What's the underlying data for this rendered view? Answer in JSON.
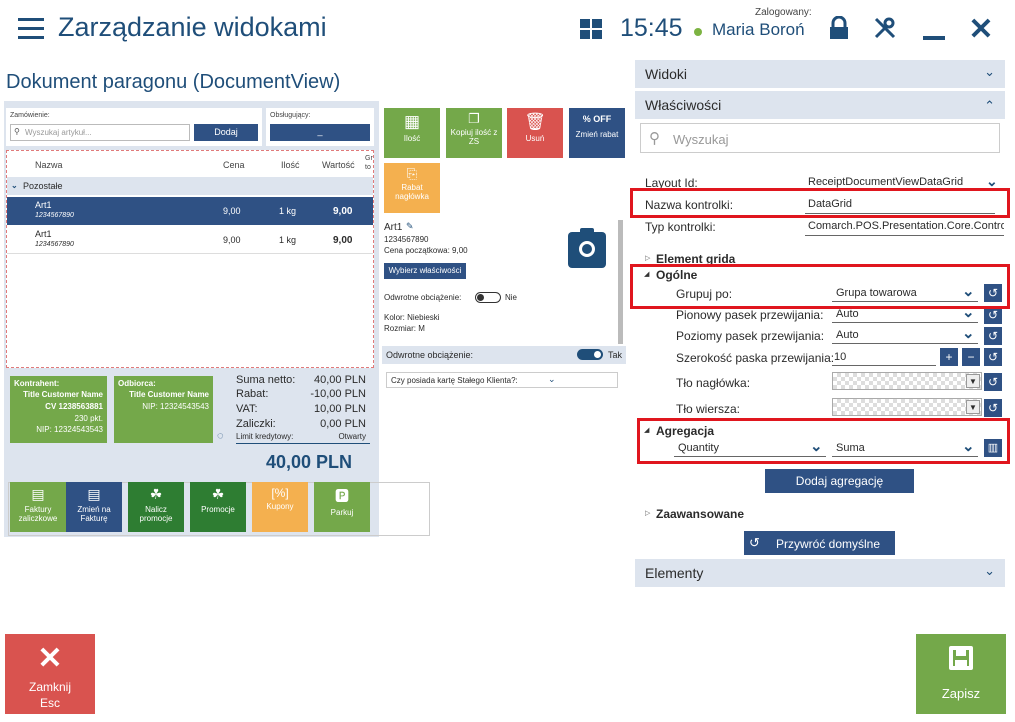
{
  "header": {
    "title": "Zarządzanie widokami",
    "time": "15:45",
    "logged_label": "Zalogowany:",
    "user": "Maria Boroń"
  },
  "document": {
    "title": "Dokument paragonu (DocumentView)"
  },
  "preview": {
    "order_label": "Zamówienie:",
    "search_placeholder": "Wyszukaj artykuł...",
    "add_button": "Dodaj",
    "served_label": "Obsługujący:",
    "served_value": "_",
    "grid": {
      "columns": [
        "Nazwa",
        "Cena",
        "Ilość",
        "Wartość"
      ],
      "extra_col": "Gr to",
      "group": "Pozostałe",
      "rows": [
        {
          "name": "Art1",
          "code": "1234567890",
          "price": "9,00",
          "qty": "1 kg",
          "value": "9,00"
        },
        {
          "name": "Art1",
          "code": "1234567890",
          "price": "9,00",
          "qty": "1 kg",
          "value": "9,00"
        }
      ]
    },
    "tiles": [
      "Ilość",
      "Kopiuj ilość z ZS",
      "Usuń",
      "Zmień rabat",
      "Rabat nagłówka"
    ],
    "detail": {
      "name": "Art1",
      "code": "1234567890",
      "start_price": "Cena początkowa: 9,00",
      "choose_btn": "Wybierz właściwości",
      "reverse_label": "Odwrotne obciążenie:",
      "reverse_value": "Nie",
      "color": "Kolor: Niebieski",
      "size": "Rozmiar: M",
      "reverse2_label": "Odwrotne obciążenie:",
      "reverse2_value": "Tak",
      "loyalty": "Czy posiada kartę Stałego Klienta?:"
    },
    "contractor": {
      "label": "Kontrahent:",
      "name": "Title Customer Name",
      "cv": "CV 1238563881",
      "pts": "230 pkt.",
      "nip": "NIP: 12324543543"
    },
    "receiver": {
      "label": "Odbiorca:",
      "name": "Title Customer Name",
      "nip": "NIP: 12324543543"
    },
    "summary": {
      "rows": [
        {
          "label": "Suma netto:",
          "value": "40,00 PLN"
        },
        {
          "label": "Rabat:",
          "value": "-10,00 PLN"
        },
        {
          "label": "VAT:",
          "value": "10,00 PLN"
        },
        {
          "label": "Zaliczki:",
          "value": "0,00 PLN"
        }
      ],
      "credit_label": "Limit kredytowy:",
      "credit_value": "Otwarty",
      "total": "40,00 PLN"
    },
    "bottom_tiles": [
      "Faktury zaliczkowe",
      "Zmień na Fakturę",
      "Nalicz promocje",
      "Promocje",
      "Kupony",
      "Parkuj"
    ]
  },
  "panel": {
    "sections": {
      "views": "Widoki",
      "properties": "Właściwości",
      "elements": "Elementy"
    },
    "search_placeholder": "Wyszukaj",
    "layout_id_label": "Layout Id:",
    "layout_id_value": "ReceiptDocumentViewDataGrid",
    "control_name_label": "Nazwa kontrolki:",
    "control_name_value": "DataGrid",
    "control_type_label": "Typ kontrolki:",
    "control_type_value": "Comarch.POS.Presentation.Core.Contro",
    "grid_element": "Element grida",
    "general": "Ogólne",
    "group_by_label": "Grupuj po:",
    "group_by_value": "Grupa towarowa",
    "vscroll_label": "Pionowy pasek przewijania:",
    "vscroll_value": "Auto",
    "hscroll_label": "Poziomy pasek przewijania:",
    "hscroll_value": "Auto",
    "scroll_width_label": "Szerokość paska przewijania:",
    "scroll_width_value": "10",
    "header_bg_label": "Tło nagłówka:",
    "row_bg_label": "Tło wiersza:",
    "aggregation": "Agregacja",
    "agg_field": "Quantity",
    "agg_func": "Suma",
    "add_agg_button": "Dodaj agregację",
    "advanced": "Zaawansowane",
    "restore_button": "Przywróć domyślne"
  },
  "footer": {
    "close_label": "Zamknij",
    "close_sub": "Esc",
    "save_label": "Zapisz"
  },
  "colors": {
    "accent": "#1f4e79",
    "navy": "#2f5184",
    "green": "#74a84a",
    "red": "#d9534f",
    "highlight": "#e0161e"
  }
}
